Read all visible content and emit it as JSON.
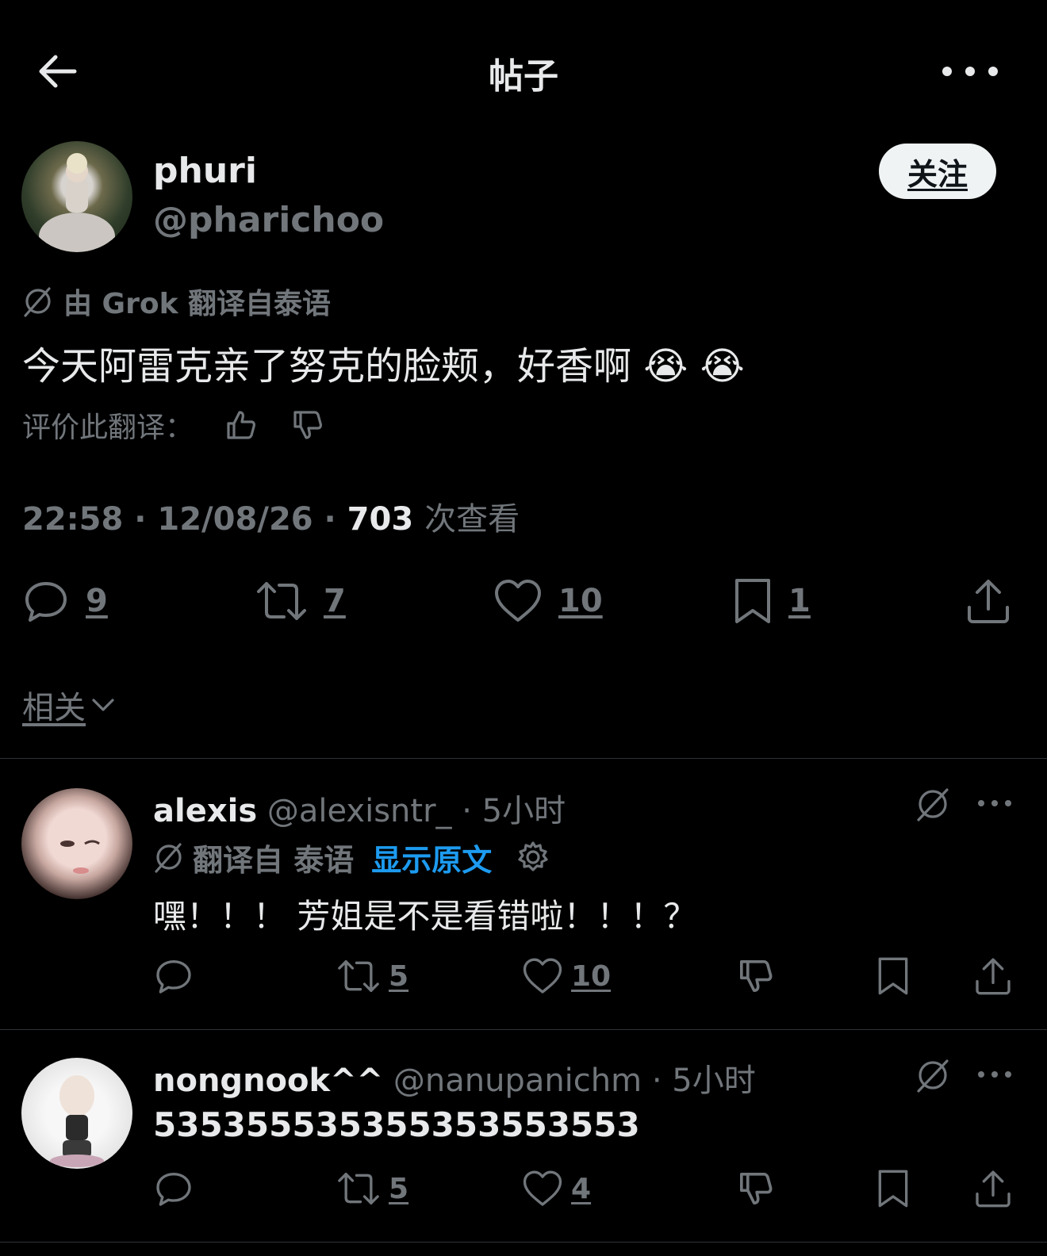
{
  "header": {
    "title": "帖子"
  },
  "post": {
    "name": "phuri",
    "handle": "@pharichoo",
    "follow_label": "关注",
    "translation_note": "由 Grok 翻译自泰语",
    "text": "今天阿雷克亲了努克的脸颊，好香啊 😭 😭",
    "rate_label": "评价此翻译：",
    "time": "22:58",
    "date": "12/08/26",
    "views": "703",
    "views_label": "次查看",
    "replies": "9",
    "reposts": "7",
    "likes": "10",
    "bookmarks": "1"
  },
  "related_label": "相关",
  "replies": [
    {
      "name": "alexis",
      "handle": "@alexisntr_",
      "time": "5小时",
      "translation_note": "翻译自 泰语",
      "show_original": "显示原文",
      "text": "嘿！！！ 芳姐是不是看错啦！！！？",
      "reposts": "5",
      "likes": "10"
    },
    {
      "name": "nongnook^^",
      "handle": "@nanupanichm",
      "time": "5小时",
      "text": "535355535355353553553",
      "reposts": "5",
      "likes": "4"
    }
  ]
}
